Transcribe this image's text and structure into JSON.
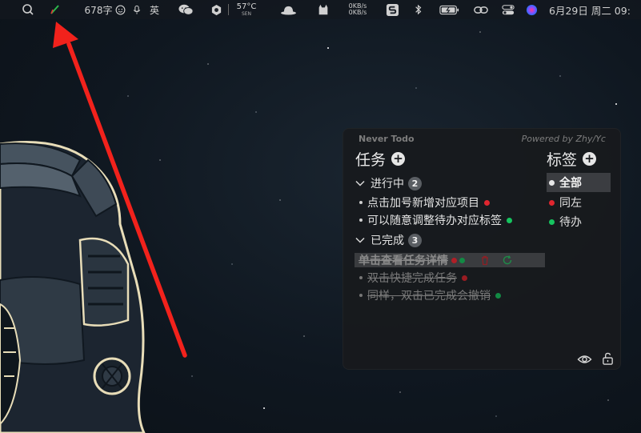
{
  "menubar": {
    "word_count": "678字",
    "input_method": "英",
    "temperature": "57°C",
    "temp_sensor": "SEN",
    "net_up": "0KB/s",
    "net_down": "0KB/s",
    "datetime": "6月29日 周二  09:",
    "icons": [
      "search-person-icon",
      "pencil-icon",
      "emoji-icon",
      "microphone-icon",
      "wechat-icon",
      "hexagon-icon",
      "hat-icon",
      "cat-icon",
      "s-app-icon",
      "bluetooth-icon",
      "battery-icon",
      "link-icon",
      "control-center-icon",
      "siri-icon"
    ]
  },
  "widget": {
    "app_name": "Never Todo",
    "powered_by": "Powered by Zhy/Yc",
    "tasks_title": "任务",
    "tags_title": "标签",
    "in_progress": {
      "label": "进行中",
      "count": "2",
      "items": [
        {
          "text": "点击加号新增对应项目",
          "tag_color": "#e0262f"
        },
        {
          "text": "可以随意调整待办对应标签",
          "tag_color": "#16c45f"
        }
      ]
    },
    "completed": {
      "label": "已完成",
      "count": "3",
      "items": [
        {
          "text": "单击查看任务详情",
          "tag_colors": [
            "#b01f27",
            "#128a44"
          ]
        },
        {
          "text": "双击快捷完成任务",
          "tag_color": "#9a1c22"
        },
        {
          "text": "同样，双击已完成会撤销",
          "tag_color": "#128a44"
        }
      ]
    },
    "tags": [
      {
        "label": "全部",
        "color": "#e8e8e8",
        "active": true
      },
      {
        "label": "同左",
        "color": "#e0262f"
      },
      {
        "label": "待办",
        "color": "#16c45f"
      }
    ]
  },
  "colors": {
    "annotation_arrow": "#f2221c",
    "widget_bg": "#181a1d"
  }
}
